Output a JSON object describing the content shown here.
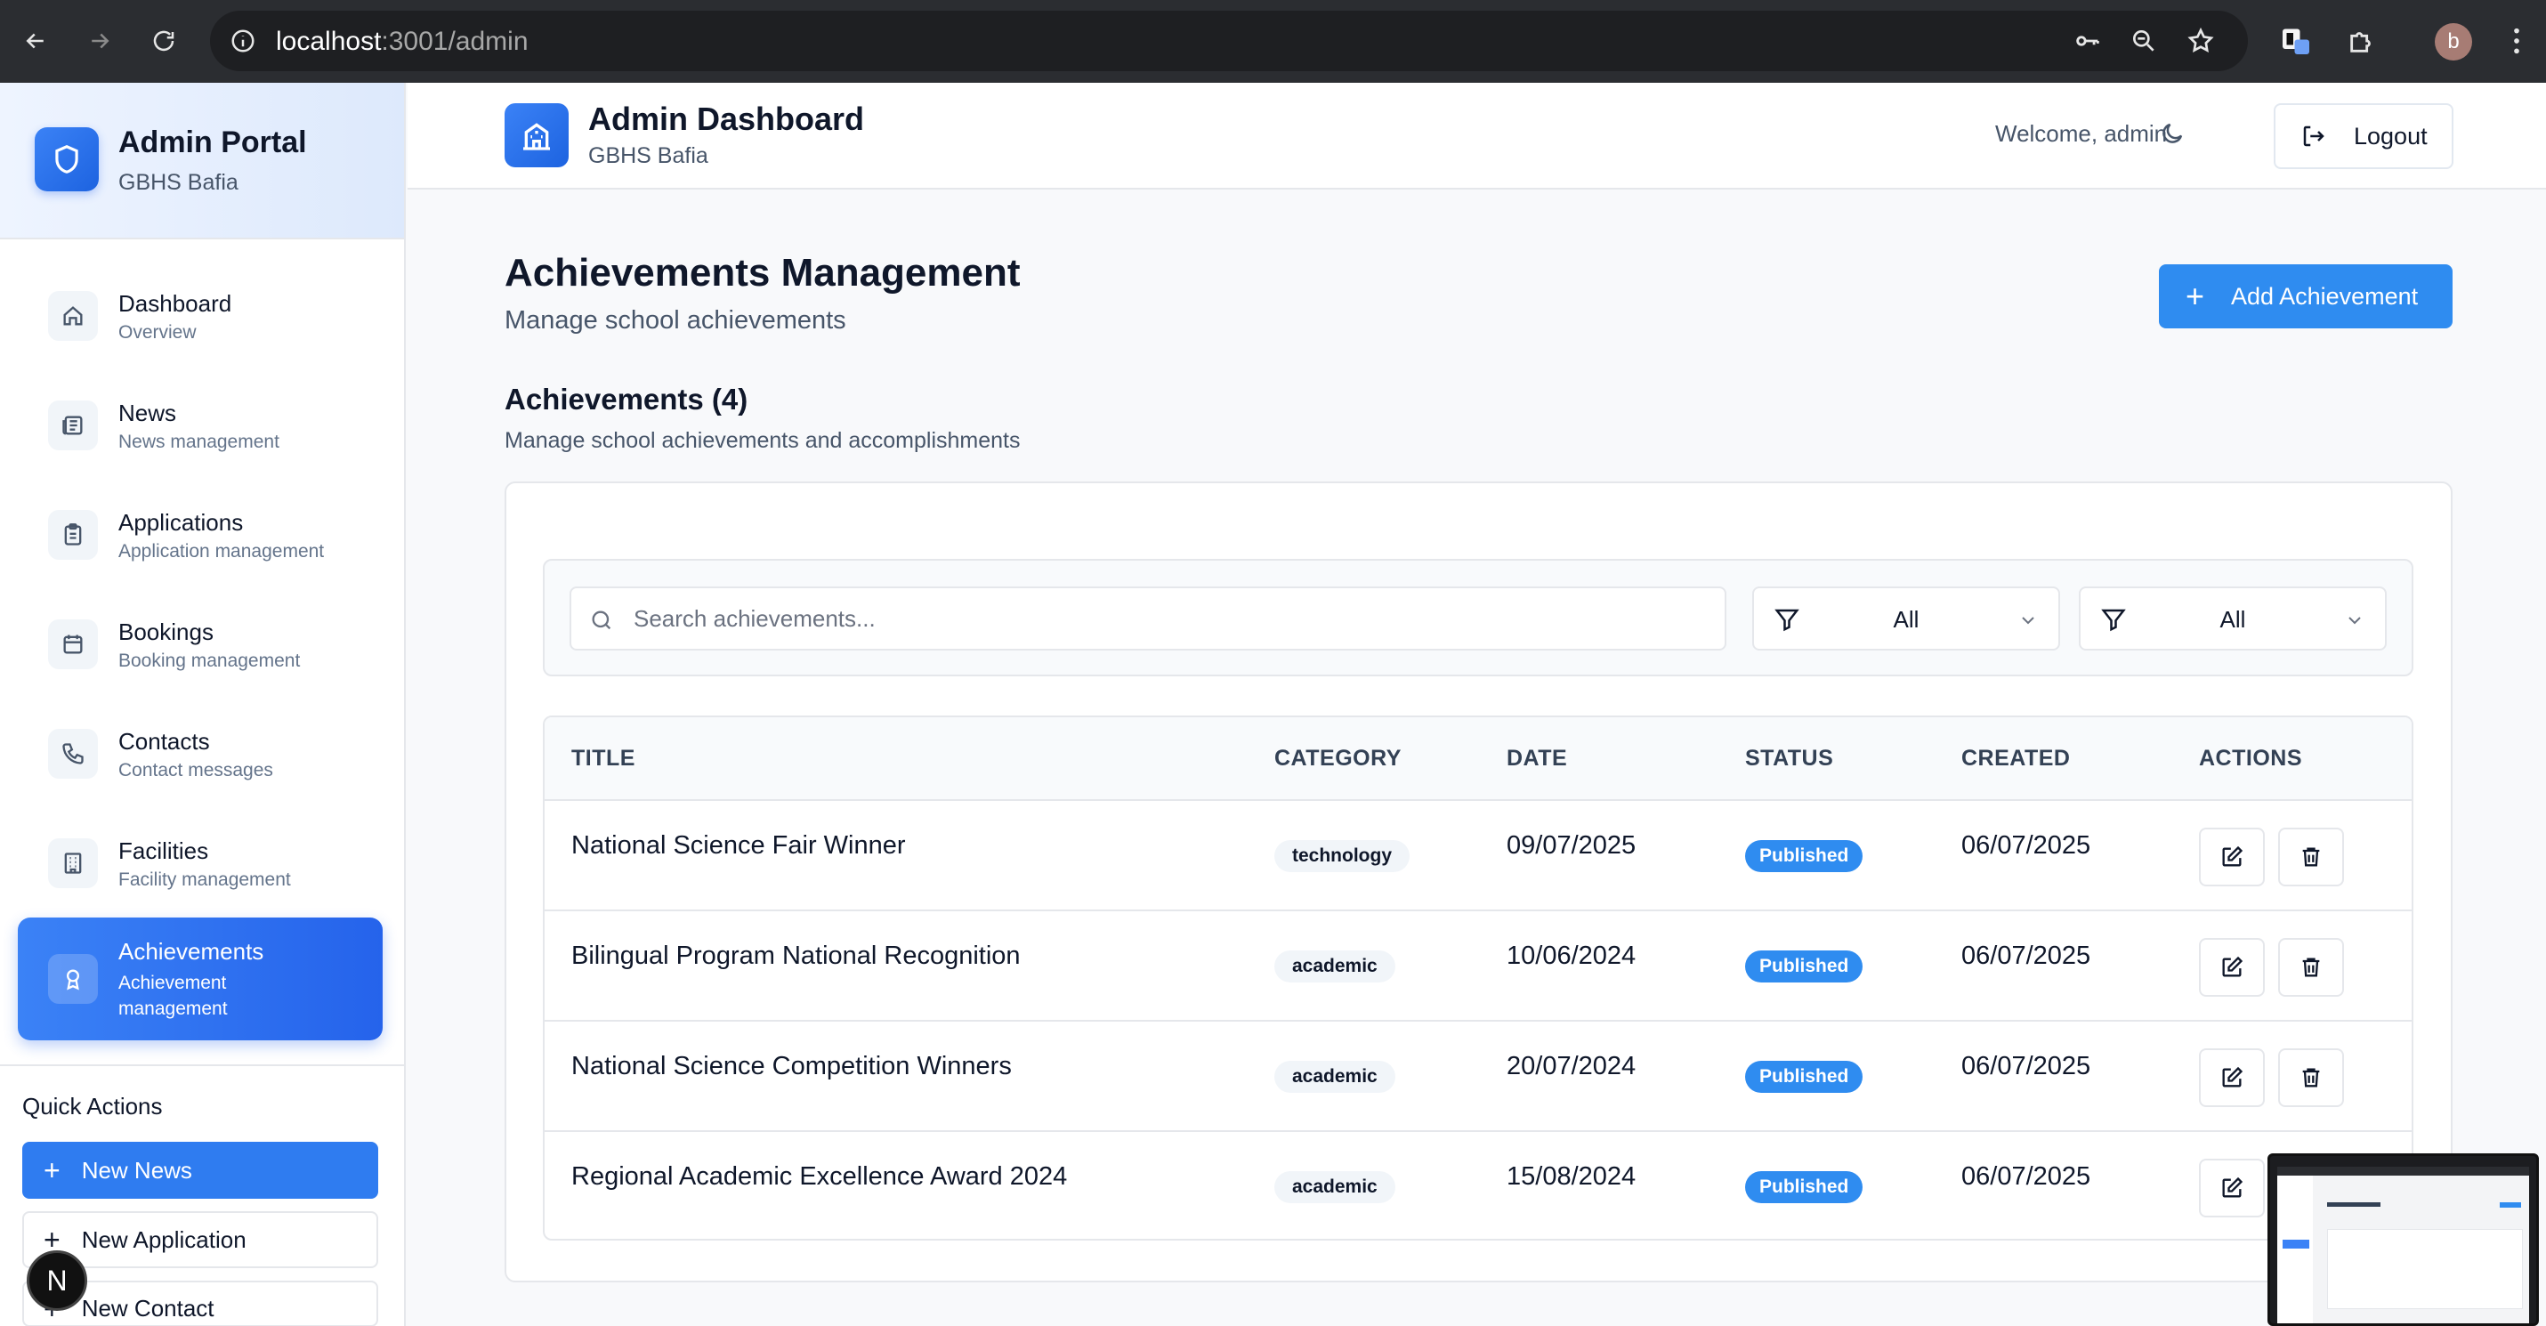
{
  "browser": {
    "url_host": "localhost",
    "url_rest": ":3001/admin",
    "profile_initial": "b"
  },
  "sidebar": {
    "title": "Admin Portal",
    "subtitle": "GBHS Bafia",
    "items": [
      {
        "label": "Dashboard",
        "desc": "Overview",
        "icon": "home-icon"
      },
      {
        "label": "News",
        "desc": "News management",
        "icon": "newspaper-icon"
      },
      {
        "label": "Applications",
        "desc": "Application management",
        "icon": "clipboard-icon"
      },
      {
        "label": "Bookings",
        "desc": "Booking management",
        "icon": "calendar-icon"
      },
      {
        "label": "Contacts",
        "desc": "Contact messages",
        "icon": "phone-icon"
      },
      {
        "label": "Facilities",
        "desc": "Facility management",
        "icon": "building-icon"
      },
      {
        "label": "Achievements",
        "desc": "Achievement management",
        "icon": "award-icon",
        "active": true
      }
    ],
    "quick_actions_title": "Quick Actions",
    "quick_actions": [
      "New News",
      "New Application",
      "New Contact"
    ]
  },
  "header": {
    "title": "Admin Dashboard",
    "subtitle": "GBHS Bafia",
    "welcome": "Welcome, admin",
    "logout": "Logout"
  },
  "page": {
    "title": "Achievements Management",
    "subtitle": "Manage school achievements",
    "add_button": "Add Achievement",
    "section_title": "Achievements (4)",
    "section_subtitle": "Manage school achievements and accomplishments",
    "search_placeholder": "Search achievements...",
    "filter1_value": "All",
    "filter2_value": "All"
  },
  "table": {
    "columns": [
      "TITLE",
      "CATEGORY",
      "DATE",
      "STATUS",
      "CREATED",
      "ACTIONS"
    ],
    "rows": [
      {
        "title": "National Science Fair Winner",
        "category": "technology",
        "date": "09/07/2025",
        "status": "Published",
        "created": "06/07/2025"
      },
      {
        "title": "Bilingual Program National Recognition",
        "category": "academic",
        "date": "10/06/2024",
        "status": "Published",
        "created": "06/07/2025"
      },
      {
        "title": "National Science Competition Winners",
        "category": "academic",
        "date": "20/07/2024",
        "status": "Published",
        "created": "06/07/2025"
      },
      {
        "title": "Regional Academic Excellence Award 2024",
        "category": "academic",
        "date": "15/08/2024",
        "status": "Published",
        "created": "06/07/2025"
      }
    ]
  },
  "colors": {
    "primary": "#2f8cf0",
    "sidebar_active": "#2563eb",
    "chrome": "#2b2d31"
  },
  "misc": {
    "next_badge": "N"
  }
}
